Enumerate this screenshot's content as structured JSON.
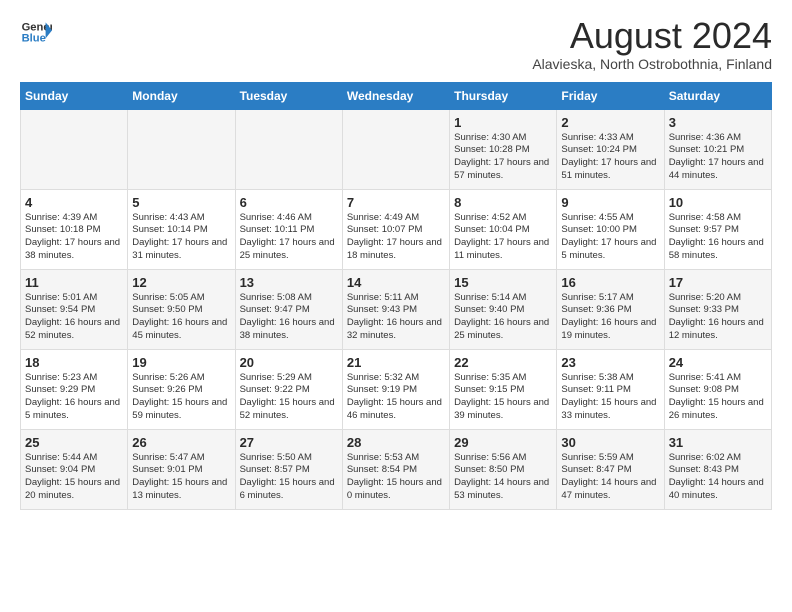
{
  "logo": {
    "line1": "General",
    "line2": "Blue"
  },
  "title": "August 2024",
  "location": "Alavieska, North Ostrobothnia, Finland",
  "weekdays": [
    "Sunday",
    "Monday",
    "Tuesday",
    "Wednesday",
    "Thursday",
    "Friday",
    "Saturday"
  ],
  "weeks": [
    [
      {
        "day": "",
        "sunrise": "",
        "sunset": "",
        "daylight": ""
      },
      {
        "day": "",
        "sunrise": "",
        "sunset": "",
        "daylight": ""
      },
      {
        "day": "",
        "sunrise": "",
        "sunset": "",
        "daylight": ""
      },
      {
        "day": "",
        "sunrise": "",
        "sunset": "",
        "daylight": ""
      },
      {
        "day": "1",
        "sunrise": "Sunrise: 4:30 AM",
        "sunset": "Sunset: 10:28 PM",
        "daylight": "Daylight: 17 hours and 57 minutes."
      },
      {
        "day": "2",
        "sunrise": "Sunrise: 4:33 AM",
        "sunset": "Sunset: 10:24 PM",
        "daylight": "Daylight: 17 hours and 51 minutes."
      },
      {
        "day": "3",
        "sunrise": "Sunrise: 4:36 AM",
        "sunset": "Sunset: 10:21 PM",
        "daylight": "Daylight: 17 hours and 44 minutes."
      }
    ],
    [
      {
        "day": "4",
        "sunrise": "Sunrise: 4:39 AM",
        "sunset": "Sunset: 10:18 PM",
        "daylight": "Daylight: 17 hours and 38 minutes."
      },
      {
        "day": "5",
        "sunrise": "Sunrise: 4:43 AM",
        "sunset": "Sunset: 10:14 PM",
        "daylight": "Daylight: 17 hours and 31 minutes."
      },
      {
        "day": "6",
        "sunrise": "Sunrise: 4:46 AM",
        "sunset": "Sunset: 10:11 PM",
        "daylight": "Daylight: 17 hours and 25 minutes."
      },
      {
        "day": "7",
        "sunrise": "Sunrise: 4:49 AM",
        "sunset": "Sunset: 10:07 PM",
        "daylight": "Daylight: 17 hours and 18 minutes."
      },
      {
        "day": "8",
        "sunrise": "Sunrise: 4:52 AM",
        "sunset": "Sunset: 10:04 PM",
        "daylight": "Daylight: 17 hours and 11 minutes."
      },
      {
        "day": "9",
        "sunrise": "Sunrise: 4:55 AM",
        "sunset": "Sunset: 10:00 PM",
        "daylight": "Daylight: 17 hours and 5 minutes."
      },
      {
        "day": "10",
        "sunrise": "Sunrise: 4:58 AM",
        "sunset": "Sunset: 9:57 PM",
        "daylight": "Daylight: 16 hours and 58 minutes."
      }
    ],
    [
      {
        "day": "11",
        "sunrise": "Sunrise: 5:01 AM",
        "sunset": "Sunset: 9:54 PM",
        "daylight": "Daylight: 16 hours and 52 minutes."
      },
      {
        "day": "12",
        "sunrise": "Sunrise: 5:05 AM",
        "sunset": "Sunset: 9:50 PM",
        "daylight": "Daylight: 16 hours and 45 minutes."
      },
      {
        "day": "13",
        "sunrise": "Sunrise: 5:08 AM",
        "sunset": "Sunset: 9:47 PM",
        "daylight": "Daylight: 16 hours and 38 minutes."
      },
      {
        "day": "14",
        "sunrise": "Sunrise: 5:11 AM",
        "sunset": "Sunset: 9:43 PM",
        "daylight": "Daylight: 16 hours and 32 minutes."
      },
      {
        "day": "15",
        "sunrise": "Sunrise: 5:14 AM",
        "sunset": "Sunset: 9:40 PM",
        "daylight": "Daylight: 16 hours and 25 minutes."
      },
      {
        "day": "16",
        "sunrise": "Sunrise: 5:17 AM",
        "sunset": "Sunset: 9:36 PM",
        "daylight": "Daylight: 16 hours and 19 minutes."
      },
      {
        "day": "17",
        "sunrise": "Sunrise: 5:20 AM",
        "sunset": "Sunset: 9:33 PM",
        "daylight": "Daylight: 16 hours and 12 minutes."
      }
    ],
    [
      {
        "day": "18",
        "sunrise": "Sunrise: 5:23 AM",
        "sunset": "Sunset: 9:29 PM",
        "daylight": "Daylight: 16 hours and 5 minutes."
      },
      {
        "day": "19",
        "sunrise": "Sunrise: 5:26 AM",
        "sunset": "Sunset: 9:26 PM",
        "daylight": "Daylight: 15 hours and 59 minutes."
      },
      {
        "day": "20",
        "sunrise": "Sunrise: 5:29 AM",
        "sunset": "Sunset: 9:22 PM",
        "daylight": "Daylight: 15 hours and 52 minutes."
      },
      {
        "day": "21",
        "sunrise": "Sunrise: 5:32 AM",
        "sunset": "Sunset: 9:19 PM",
        "daylight": "Daylight: 15 hours and 46 minutes."
      },
      {
        "day": "22",
        "sunrise": "Sunrise: 5:35 AM",
        "sunset": "Sunset: 9:15 PM",
        "daylight": "Daylight: 15 hours and 39 minutes."
      },
      {
        "day": "23",
        "sunrise": "Sunrise: 5:38 AM",
        "sunset": "Sunset: 9:11 PM",
        "daylight": "Daylight: 15 hours and 33 minutes."
      },
      {
        "day": "24",
        "sunrise": "Sunrise: 5:41 AM",
        "sunset": "Sunset: 9:08 PM",
        "daylight": "Daylight: 15 hours and 26 minutes."
      }
    ],
    [
      {
        "day": "25",
        "sunrise": "Sunrise: 5:44 AM",
        "sunset": "Sunset: 9:04 PM",
        "daylight": "Daylight: 15 hours and 20 minutes."
      },
      {
        "day": "26",
        "sunrise": "Sunrise: 5:47 AM",
        "sunset": "Sunset: 9:01 PM",
        "daylight": "Daylight: 15 hours and 13 minutes."
      },
      {
        "day": "27",
        "sunrise": "Sunrise: 5:50 AM",
        "sunset": "Sunset: 8:57 PM",
        "daylight": "Daylight: 15 hours and 6 minutes."
      },
      {
        "day": "28",
        "sunrise": "Sunrise: 5:53 AM",
        "sunset": "Sunset: 8:54 PM",
        "daylight": "Daylight: 15 hours and 0 minutes."
      },
      {
        "day": "29",
        "sunrise": "Sunrise: 5:56 AM",
        "sunset": "Sunset: 8:50 PM",
        "daylight": "Daylight: 14 hours and 53 minutes."
      },
      {
        "day": "30",
        "sunrise": "Sunrise: 5:59 AM",
        "sunset": "Sunset: 8:47 PM",
        "daylight": "Daylight: 14 hours and 47 minutes."
      },
      {
        "day": "31",
        "sunrise": "Sunrise: 6:02 AM",
        "sunset": "Sunset: 8:43 PM",
        "daylight": "Daylight: 14 hours and 40 minutes."
      }
    ]
  ]
}
